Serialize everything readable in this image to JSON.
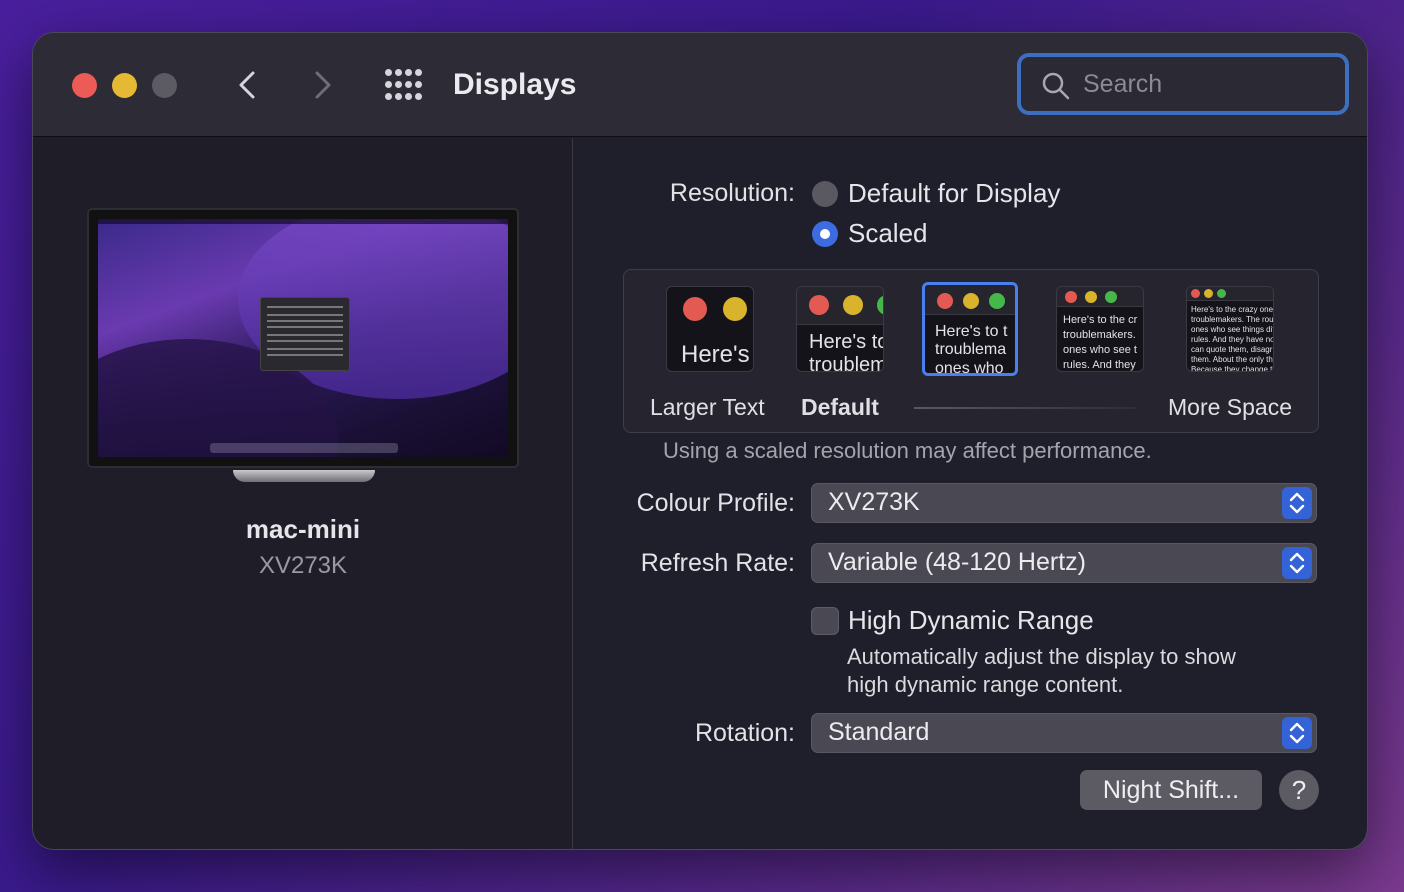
{
  "window": {
    "title": "Displays",
    "search_placeholder": "Search"
  },
  "icons": {
    "back": "chevron-left-icon",
    "forward": "chevron-right-icon",
    "all_prefs": "grid-icon",
    "search": "magnifier-icon"
  },
  "device": {
    "name": "mac-mini",
    "model": "XV273K"
  },
  "resolution": {
    "label": "Resolution:",
    "options": [
      "Default for Display",
      "Scaled"
    ],
    "selected": "Scaled"
  },
  "scaling": {
    "thumbnails": [
      {
        "text": "Here's",
        "selected": false
      },
      {
        "text": "Here's to\ntroublem",
        "selected": false
      },
      {
        "text": "Here's to t\ntroublema\nones who",
        "selected": true
      },
      {
        "text": "Here's to the cr\ntroublemakers.\nones who see t\nrules. And they",
        "selected": false
      },
      {
        "text": "Here's to the crazy ones\ntroublemakers. The rou\nones who see things dif\nrules. And they have no\ncan quote them, disagr\nthem. About the only th\nBecause they change th",
        "selected": false
      }
    ],
    "labels": {
      "larger": "Larger Text",
      "default": "Default",
      "more": "More Space"
    },
    "note": "Using a scaled resolution may affect performance."
  },
  "colour_profile": {
    "label": "Colour Profile:",
    "value": "XV273K"
  },
  "refresh_rate": {
    "label": "Refresh Rate:",
    "value": "Variable (48-120 Hertz)"
  },
  "hdr": {
    "label": "High Dynamic Range",
    "checked": false,
    "description_line1": "Automatically adjust the display to show",
    "description_line2": "high dynamic range content."
  },
  "rotation": {
    "label": "Rotation:",
    "value": "Standard"
  },
  "buttons": {
    "night_shift": "Night Shift...",
    "help": "?"
  },
  "colors": {
    "accent": "#3d6be0",
    "close": "#ec5b55",
    "minimize": "#e6b934",
    "maximize_disabled": "#5c5b63"
  }
}
